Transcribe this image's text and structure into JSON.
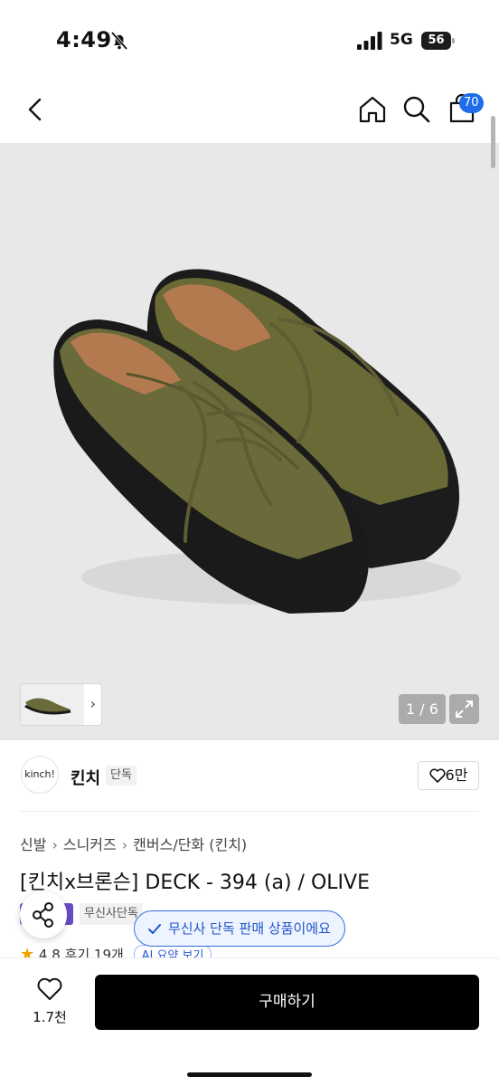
{
  "status_bar": {
    "time": "4:49",
    "network": "5G",
    "battery": "56",
    "icons": [
      "bell-slash-icon",
      "signal-icon",
      "battery-icon"
    ]
  },
  "nav": {
    "icons": [
      "back-icon",
      "home-icon",
      "search-icon",
      "cart-icon"
    ],
    "cart_count": "70"
  },
  "gallery": {
    "pager": "1 / 6",
    "thumb_arrow": "›",
    "colors": {
      "background": "#e8e8e8",
      "canvas": "#6b6a3a",
      "sole": "#1a1a1a"
    }
  },
  "brand": {
    "logo_text": "kinch!",
    "name": "킨치",
    "tag": "단독",
    "likes": "6만"
  },
  "product": {
    "breadcrumb": [
      "신발",
      "스니커즈",
      "캔버스/단화 (킨치)"
    ],
    "title": "[킨치x브론슨] DECK - 394 (a) / OLIVE",
    "badge": "무신사단독",
    "toast": "무신사 단독 판매 상품이에요",
    "rating": "4.8",
    "reviews": "후기 19개",
    "ai_summary": "AI 요약 보기"
  },
  "bottom_bar": {
    "wish_count": "1.7천",
    "buy_label": "구매하기"
  },
  "colors": {
    "accent": "#1f6de9",
    "badge_purple": "#6b4cc9",
    "buy_button": "#000000",
    "star": "#f2a300"
  }
}
